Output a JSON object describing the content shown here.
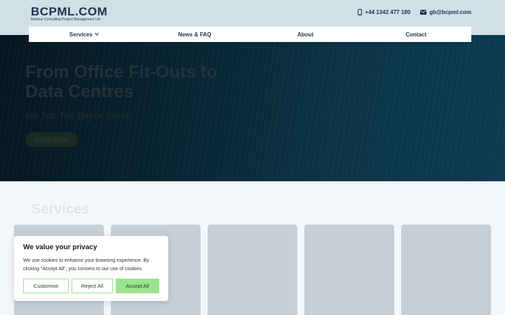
{
  "header": {
    "logo_main": "BCPML.COM",
    "logo_sub": "Barbour Consulting Project Management Ltd",
    "phone": "+44 1342 477 180",
    "email": "gb@bcpml.com"
  },
  "nav": {
    "items": [
      "Services",
      "News & FAQ",
      "About",
      "Contact"
    ]
  },
  "hero": {
    "title": "From Office Fit-Outs to Data Centres",
    "subtitle": "No Job Too Big or Small",
    "cta": "Get in touch"
  },
  "services": {
    "title": "Services"
  },
  "cookie": {
    "title": "We value your privacy",
    "text": "We use cookies to enhance your browsing experience. By clicking \"Accept All\", you consent to our use of cookies.",
    "customise": "Customise",
    "reject": "Reject All",
    "accept": "Accept All"
  },
  "colors": {
    "brand": "#1a3550",
    "accept_green": "#9be38e",
    "topbar": "#d3dfe7",
    "card": "#c4cfd7"
  }
}
